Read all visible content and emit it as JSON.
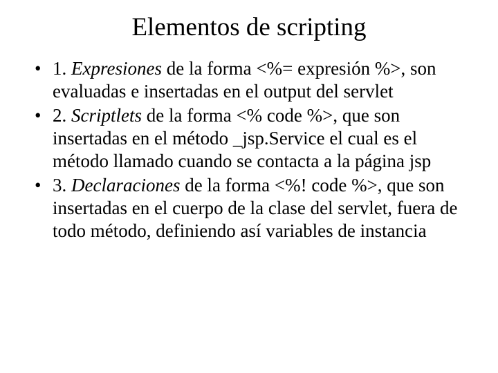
{
  "title": "Elementos de scripting",
  "bullets": [
    {
      "num": "1. ",
      "em": "Expresiones",
      "rest": " de la forma <%= expresión %>, son evaluadas e insertadas en el output del servlet"
    },
    {
      "num": "2. ",
      "em": "Scriptlets",
      "rest": " de la forma <% code %>, que son insertadas en el método _jsp.Service el cual es el método llamado  cuando se contacta a la página jsp"
    },
    {
      "num": "3. ",
      "em": "Declaraciones",
      "rest": " de la forma <%! code %>, que son insertadas en el cuerpo de la clase del servlet, fuera de todo método, definiendo así variables de instancia"
    }
  ]
}
